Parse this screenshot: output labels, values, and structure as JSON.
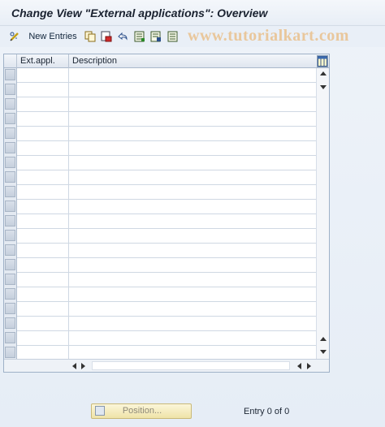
{
  "title": "Change View \"External applications\": Overview",
  "toolbar": {
    "new_entries_label": "New Entries",
    "icons": [
      "pencil-glasses-icon",
      "copy-icon",
      "delete-icon",
      "undo-icon",
      "select-all-icon",
      "select-block-icon",
      "deselect-all-icon"
    ]
  },
  "watermark": "www.tutorialkart.com",
  "table": {
    "columns": [
      "Ext.appl.",
      "Description"
    ],
    "rows": [
      [
        "",
        ""
      ],
      [
        "",
        ""
      ],
      [
        "",
        ""
      ],
      [
        "",
        ""
      ],
      [
        "",
        ""
      ],
      [
        "",
        ""
      ],
      [
        "",
        ""
      ],
      [
        "",
        ""
      ],
      [
        "",
        ""
      ],
      [
        "",
        ""
      ],
      [
        "",
        ""
      ],
      [
        "",
        ""
      ],
      [
        "",
        ""
      ],
      [
        "",
        ""
      ],
      [
        "",
        ""
      ],
      [
        "",
        ""
      ],
      [
        "",
        ""
      ],
      [
        "",
        ""
      ],
      [
        "",
        ""
      ],
      [
        "",
        ""
      ]
    ]
  },
  "footer": {
    "position_button": "Position...",
    "entry_info": "Entry 0 of 0"
  },
  "colors": {
    "background": "#e6edf6",
    "grid_border": "#9fb1c7",
    "position_button": "#efe3a8",
    "watermark": "#e9c79c"
  }
}
